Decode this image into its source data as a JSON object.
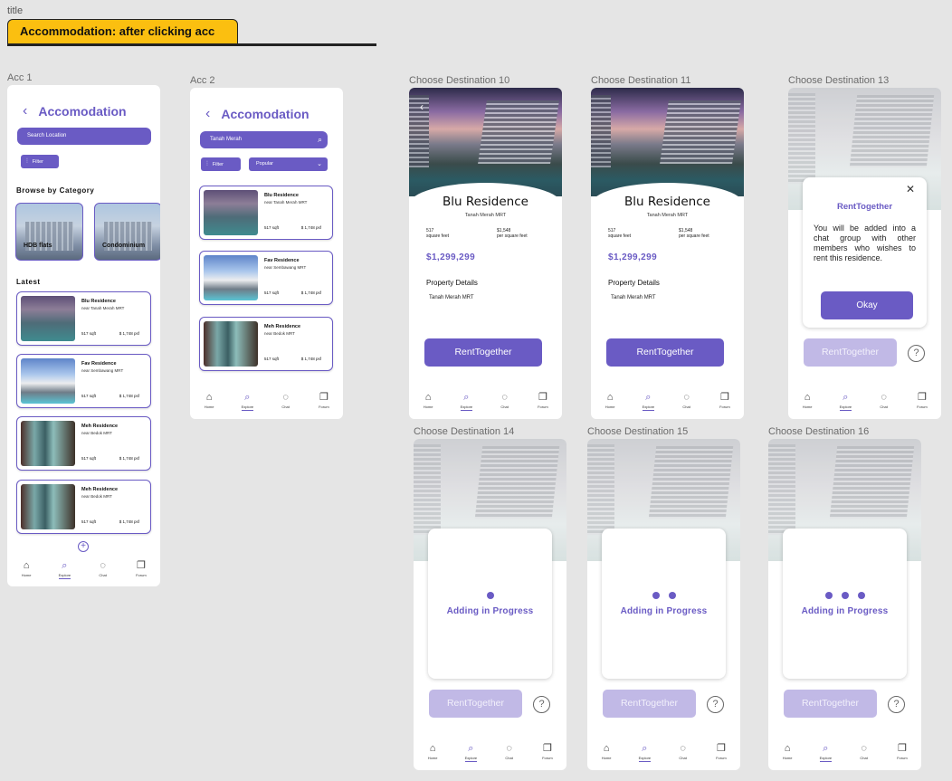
{
  "section": {
    "label": "title",
    "title": "Accommodation: after clicking acc"
  },
  "nav": [
    "Home",
    "Explore",
    "Chat",
    "Forum"
  ],
  "acc1": {
    "frame_label": "Acc 1",
    "header": "Accomodation",
    "search_placeholder": "Search Location",
    "filter_label": "Filter",
    "browse_heading": "Browse by Category",
    "categories": [
      "HDB flats",
      "Condominium"
    ],
    "latest_heading": "Latest",
    "listings": [
      {
        "name": "Blu Residence",
        "near": "near Tanah Merah MRT",
        "sqft": "517 sqft",
        "price": "$ 1,748 psf"
      },
      {
        "name": "Fav Residence",
        "near": "near Sembawang MRT",
        "sqft": "517 sqft",
        "price": "$ 1,748 psf"
      },
      {
        "name": "Meh Residence",
        "near": "near Bedok MRT",
        "sqft": "517 sqft",
        "price": "$ 1,748 psf"
      },
      {
        "name": "Meh Residence",
        "near": "near Bedok MRT",
        "sqft": "517 sqft",
        "price": "$ 1,748 psf"
      }
    ]
  },
  "acc2": {
    "frame_label": "Acc 2",
    "header": "Accomodation",
    "search_value": "Tanah Merah",
    "filter_label": "Filter",
    "sort_label": "Popular",
    "listings": [
      {
        "name": "Blu Residence",
        "near": "near Tanah Merah MRT",
        "sqft": "517 sqft",
        "price": "$ 1,748 psf"
      },
      {
        "name": "Fav Residence",
        "near": "near Sembawang MRT",
        "sqft": "517 sqft",
        "price": "$ 1,748 psf"
      },
      {
        "name": "Meh Residence",
        "near": "near Bedok MRT",
        "sqft": "517 sqft",
        "price": "$ 1,748 psf"
      }
    ]
  },
  "detail": {
    "name": "Blu Residence",
    "mrt": "Tanah Merah MRT",
    "area_value": "517",
    "area_unit": "square feet",
    "psf_value": "$1,548",
    "psf_unit": "per square feet",
    "price": "$1,299,299",
    "property_details": "Property Details",
    "location": "Tanah Merah MRT",
    "rent_button": "RentTogether"
  },
  "frames": {
    "d10": "Choose Destination 10",
    "d11": "Choose Destination 11",
    "d13": "Choose Destination 13",
    "d14": "Choose Destination 14",
    "d15": "Choose Destination 15",
    "d16": "Choose Destination 16"
  },
  "dialog": {
    "title": "RentTogether",
    "body": "You will be added into a chat group with other members who wishes to rent this residence.",
    "okay": "Okay"
  },
  "progress": {
    "text": "Adding in Progress",
    "dots_d14": 1,
    "dots_d15": 2,
    "dots_d16": 3
  },
  "colors": {
    "accent": "#6a5bc4",
    "accent_faded": "#c1b9e6",
    "badge": "#fbbf10"
  }
}
